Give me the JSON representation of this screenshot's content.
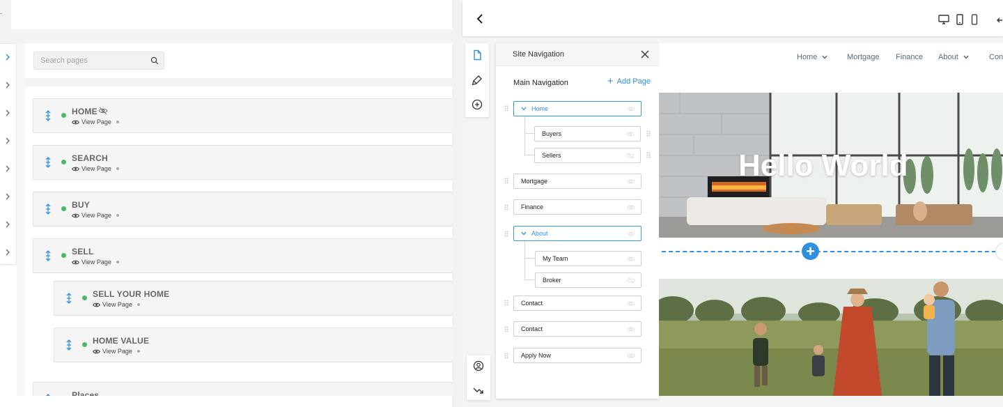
{
  "left_panel": {
    "corner_mark": "-",
    "search": {
      "placeholder": "Search pages",
      "value": ""
    },
    "pages": [
      {
        "title": "HOME",
        "hidden": true,
        "view_label": "View Page"
      },
      {
        "title": "SEARCH",
        "hidden": false,
        "view_label": "View Page"
      },
      {
        "title": "BUY",
        "hidden": false,
        "view_label": "View Page"
      },
      {
        "title": "SELL",
        "hidden": false,
        "view_label": "View Page"
      },
      {
        "title": "SELL YOUR HOME",
        "hidden": false,
        "view_label": "View Page"
      },
      {
        "title": "HOME VALUE",
        "hidden": false,
        "view_label": "View Page"
      },
      {
        "title": "Places",
        "hidden": false,
        "view_label": ""
      }
    ]
  },
  "editor": {
    "nav_panel": {
      "title": "Site Navigation",
      "section_label": "Main Navigation",
      "add_page_label": "Add Page",
      "items": [
        {
          "label": "Home",
          "expanded": true,
          "children": [
            {
              "label": "Buyers",
              "hidden": false
            },
            {
              "label": "Sellers",
              "hidden": true
            }
          ]
        },
        {
          "label": "Mortgage"
        },
        {
          "label": "Finance"
        },
        {
          "label": "About",
          "expanded": true,
          "children": [
            {
              "label": "My Team",
              "hidden": false
            },
            {
              "label": "Broker",
              "hidden": true
            }
          ]
        },
        {
          "label": "Contact"
        },
        {
          "label": "Contact"
        },
        {
          "label": "Apply Now"
        }
      ]
    },
    "preview": {
      "menu": [
        {
          "label": "Home",
          "dropdown": true
        },
        {
          "label": "Mortgage",
          "dropdown": false
        },
        {
          "label": "Finance",
          "dropdown": false
        },
        {
          "label": "About",
          "dropdown": true
        },
        {
          "label": "Con",
          "dropdown": false
        }
      ],
      "hero_heading": "Hello World"
    }
  },
  "colors": {
    "accent": "#2f8fe0",
    "status_green": "#4cb962"
  }
}
